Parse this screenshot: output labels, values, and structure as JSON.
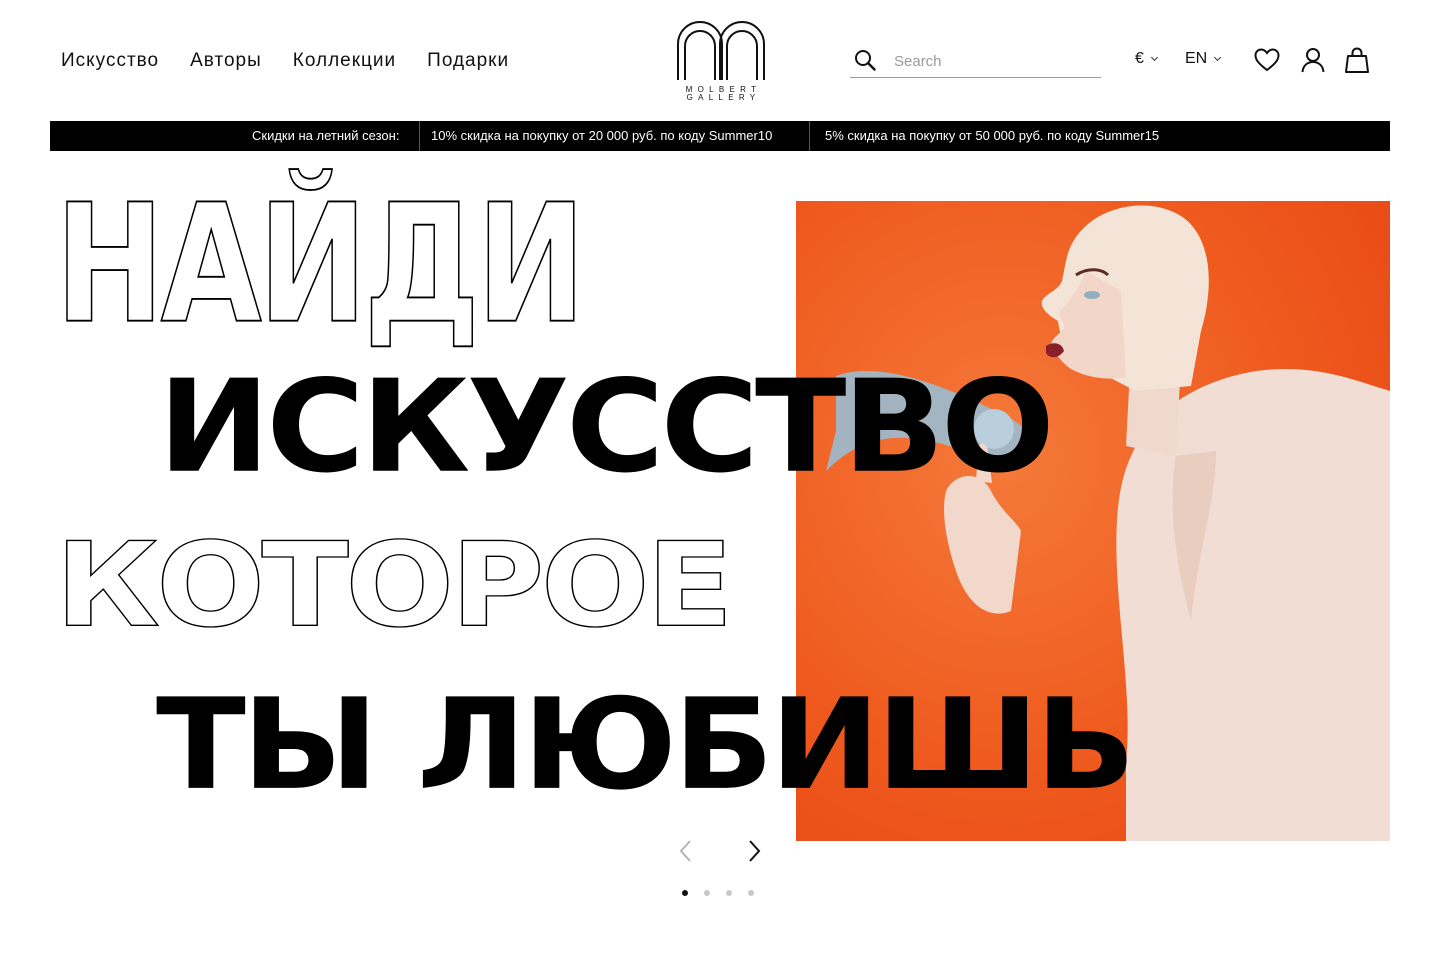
{
  "nav": {
    "items": [
      {
        "label": "Искусство"
      },
      {
        "label": "Авторы"
      },
      {
        "label": "Коллекции"
      },
      {
        "label": "Подарки"
      }
    ]
  },
  "logo": {
    "line1": "MOLBERT",
    "line2": "GALLERY"
  },
  "search": {
    "placeholder": "Search",
    "icon": "search-icon"
  },
  "currency": {
    "selected": "€"
  },
  "language": {
    "selected": "EN"
  },
  "header_icons": [
    "heart-icon",
    "user-icon",
    "shopping-bag-icon"
  ],
  "promo": {
    "intro": "Скидки на летний сезон:",
    "offer1": "10% скидка на покупку от 20 000 руб. по коду Summer10",
    "offer2": "5% скидка на покупку от 50 000 руб. по коду Summer15"
  },
  "hero": {
    "line1": "НАЙДИ",
    "line2": "ИСКУССТВО",
    "line3": "КОТОРОЕ",
    "line4": "ТЫ ЛЮБИШЬ",
    "slides_total": 4,
    "active_slide": 1
  },
  "colors": {
    "painting_background": "#ee5a1d",
    "promo_bar": "#000000",
    "active_dot": "#111111",
    "inactive_dot": "#c8c8c8"
  }
}
